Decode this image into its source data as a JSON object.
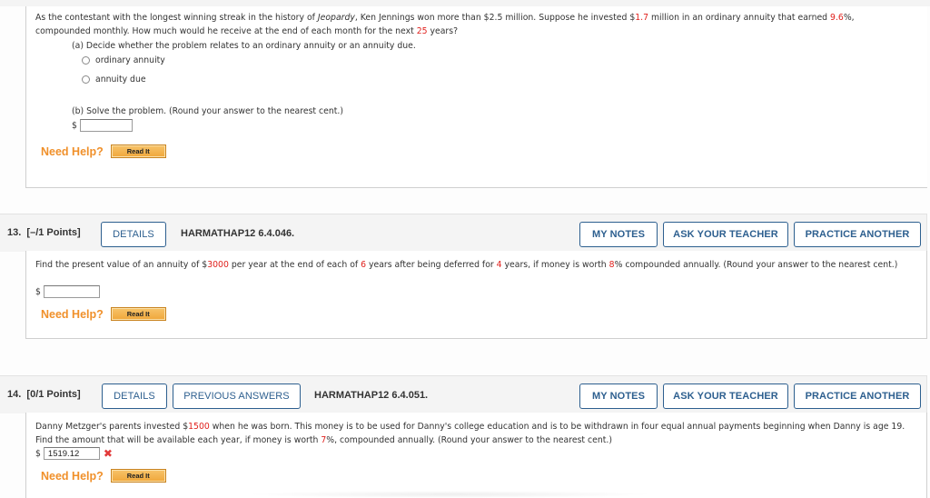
{
  "question12": {
    "text_parts": [
      {
        "t": "As the contestant with the longest winning streak in the history of "
      },
      {
        "t": "Jeopardy",
        "style": "italic"
      },
      {
        "t": ", Ken Jennings won more than $2.5 million. Suppose he invested $"
      },
      {
        "t": "1.7",
        "style": "red"
      },
      {
        "t": " million in an ordinary annuity that earned "
      },
      {
        "t": "9.6",
        "style": "red"
      },
      {
        "t": "%, compounded monthly. How much would he receive at the end of each month for the next "
      },
      {
        "t": "25",
        "style": "red"
      },
      {
        "t": " years?"
      }
    ],
    "part_a_label": "(a) Decide whether the problem relates to an ordinary annuity or an annuity due.",
    "options": [
      "ordinary annuity",
      "annuity due"
    ],
    "part_b_label": "(b) Solve the problem. (Round your answer to the nearest cent.)",
    "currency": "$",
    "answer_value": "",
    "need_help": "Need Help?",
    "read_it": "Read It"
  },
  "question13": {
    "number": "13.",
    "points": "[–/1 Points]",
    "details_label": "DETAILS",
    "problem_id": "HARMATHAP12 6.4.046.",
    "my_notes_label": "MY NOTES",
    "ask_teacher_label": "ASK YOUR TEACHER",
    "practice_label": "PRACTICE ANOTHER",
    "text_parts": [
      {
        "t": "Find the present value of an annuity of $"
      },
      {
        "t": "3000",
        "style": "red"
      },
      {
        "t": " per year at the end of each of "
      },
      {
        "t": "6",
        "style": "red"
      },
      {
        "t": " years after being deferred for "
      },
      {
        "t": "4",
        "style": "red"
      },
      {
        "t": " years, if money is worth "
      },
      {
        "t": "8",
        "style": "red"
      },
      {
        "t": "% compounded annually. (Round your answer to the nearest cent.)"
      }
    ],
    "currency": "$",
    "answer_value": "",
    "need_help": "Need Help?",
    "read_it": "Read It"
  },
  "question14": {
    "number": "14.",
    "points": "[0/1 Points]",
    "details_label": "DETAILS",
    "previous_answers_label": "PREVIOUS ANSWERS",
    "problem_id": "HARMATHAP12 6.4.051.",
    "my_notes_label": "MY NOTES",
    "ask_teacher_label": "ASK YOUR TEACHER",
    "practice_label": "PRACTICE ANOTHER",
    "text_parts": [
      {
        "t": "Danny Metzger's parents invested $"
      },
      {
        "t": "1500",
        "style": "red"
      },
      {
        "t": " when he was born. This money is to be used for Danny's college education and is to be withdrawn in four equal annual payments beginning when Danny is age 19. Find the amount that will be available each year, if money is worth "
      },
      {
        "t": "7",
        "style": "red"
      },
      {
        "t": "%, compounded annually. (Round your answer to the nearest cent.)"
      }
    ],
    "currency": "$",
    "answer_value": "1519.12",
    "answer_status_icon": "x-mark-incorrect",
    "need_help": "Need Help?",
    "read_it": "Read It"
  },
  "colors": {
    "accent_blue": "#2d5f8f",
    "highlight_red": "#e0201c",
    "help_orange": "#f0902a",
    "incorrect_red": "#e23a3a"
  }
}
